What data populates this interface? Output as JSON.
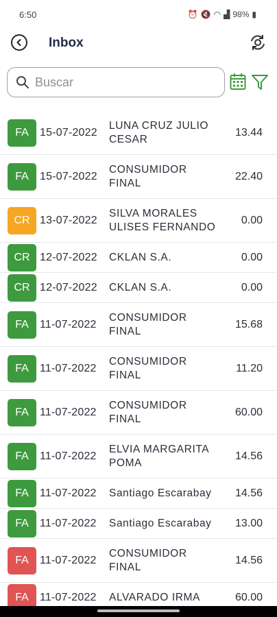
{
  "status_bar": {
    "time": "6:50",
    "battery": "98%"
  },
  "header": {
    "title": "Inbox"
  },
  "search": {
    "placeholder": "Buscar",
    "value": ""
  },
  "colors": {
    "green": "#3e9a3e",
    "orange": "#f5a623",
    "red": "#e05454",
    "accent": "#3e9a3e"
  },
  "rows": [
    {
      "type": "FA",
      "color": "green",
      "date": "15-07-2022",
      "name_lines": [
        "LUNA CRUZ JULIO",
        "CESAR"
      ],
      "amount": "13.44"
    },
    {
      "type": "FA",
      "color": "green",
      "date": "15-07-2022",
      "name_lines": [
        "CONSUMIDOR",
        "FINAL"
      ],
      "amount": "22.40"
    },
    {
      "type": "CR",
      "color": "orange",
      "date": "13-07-2022",
      "name_lines": [
        "SILVA MORALES",
        "ULISES FERNANDO"
      ],
      "amount": "0.00"
    },
    {
      "type": "CR",
      "color": "green",
      "date": "12-07-2022",
      "name_lines": [
        "CKLAN S.A."
      ],
      "amount": "0.00"
    },
    {
      "type": "CR",
      "color": "green",
      "date": "12-07-2022",
      "name_lines": [
        "CKLAN S.A."
      ],
      "amount": "0.00"
    },
    {
      "type": "FA",
      "color": "green",
      "date": "11-07-2022",
      "name_lines": [
        "CONSUMIDOR",
        "FINAL"
      ],
      "amount": "15.68"
    },
    {
      "type": "FA",
      "color": "green",
      "date": "11-07-2022",
      "name_lines": [
        "CONSUMIDOR",
        "FINAL"
      ],
      "amount": "11.20"
    },
    {
      "type": "FA",
      "color": "green",
      "date": "11-07-2022",
      "name_lines": [
        "CONSUMIDOR",
        "FINAL"
      ],
      "amount": "60.00"
    },
    {
      "type": "FA",
      "color": "green",
      "date": "11-07-2022",
      "name_lines": [
        "ELVIA MARGARITA",
        "POMA"
      ],
      "amount": "14.56"
    },
    {
      "type": "FA",
      "color": "green",
      "date": "11-07-2022",
      "name_lines": [
        "Santiago Escarabay"
      ],
      "amount": "14.56"
    },
    {
      "type": "FA",
      "color": "green",
      "date": "11-07-2022",
      "name_lines": [
        "Santiago Escarabay"
      ],
      "amount": "13.00"
    },
    {
      "type": "FA",
      "color": "red",
      "date": "11-07-2022",
      "name_lines": [
        "CONSUMIDOR",
        "FINAL"
      ],
      "amount": "14.56"
    },
    {
      "type": "FA",
      "color": "red",
      "date": "11-07-2022",
      "name_lines": [
        "ALVARADO IRMA"
      ],
      "amount": "60.00"
    }
  ]
}
